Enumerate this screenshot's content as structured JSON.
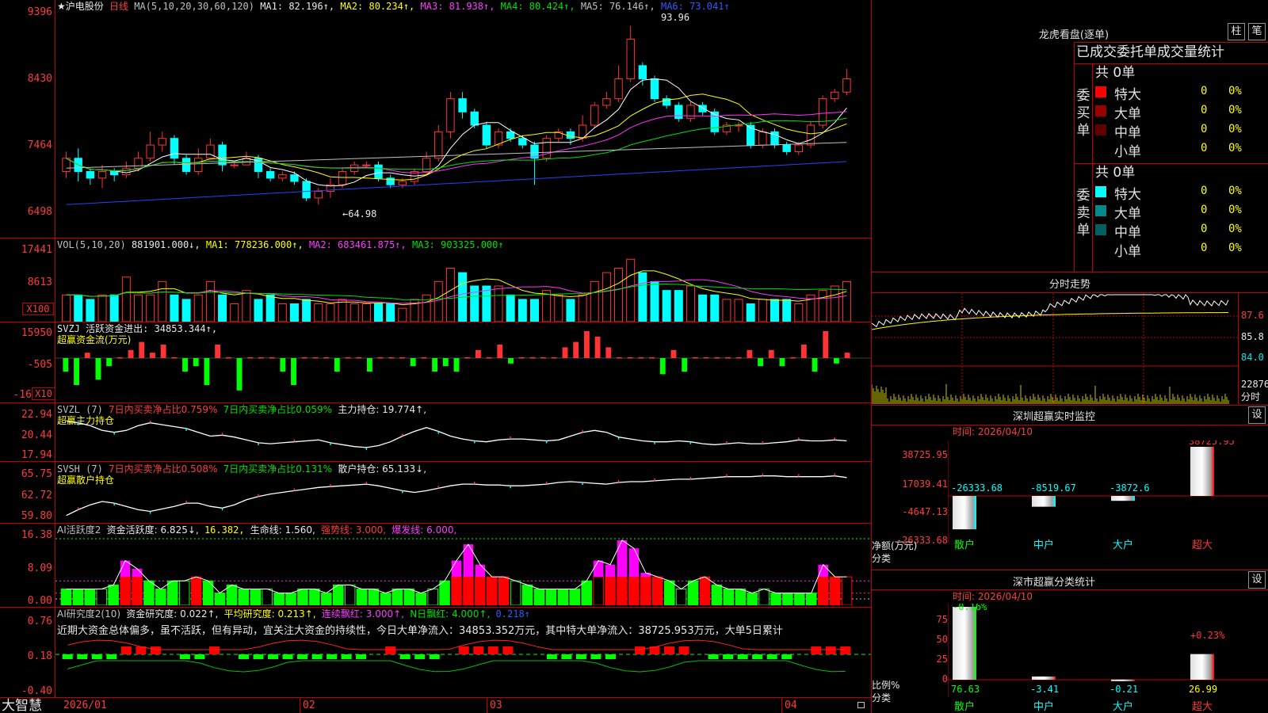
{
  "bottom_bar": {
    "brand": "大智慧",
    "dates": [
      "2026/01",
      "02",
      "03",
      "04"
    ]
  },
  "kline": {
    "stock_name": "★沪电股份",
    "period": "日线",
    "ma_params": "MA(5,10,20,30,60,120)",
    "ma1": "MA1: 82.196↑,",
    "ma2": "MA2: 80.234↑,",
    "ma3": "MA3: 81.938↑,",
    "ma4": "MA4: 80.424↑,",
    "ma5": "MA5: 76.146↑,",
    "ma6": "MA6: 73.041↑",
    "axis": [
      "9396",
      "8430",
      "7464",
      "6498"
    ],
    "high_label": "93.96",
    "low_label": "←64.98",
    "candles": [
      [
        72,
        74,
        71,
        75
      ],
      [
        74,
        72,
        70.5,
        75.5
      ],
      [
        72,
        71,
        70,
        72.5
      ],
      [
        71,
        72,
        69.5,
        73
      ],
      [
        72,
        71.5,
        70.5,
        72.5
      ],
      [
        71.5,
        72.5,
        71,
        73.5
      ],
      [
        72.5,
        74,
        72,
        75
      ],
      [
        74,
        76,
        73.5,
        78
      ],
      [
        76,
        77,
        75,
        78
      ],
      [
        77,
        74,
        73,
        77.5
      ],
      [
        74,
        72,
        71.5,
        74.5
      ],
      [
        72,
        74,
        71.5,
        75.5
      ],
      [
        74,
        76,
        74,
        77
      ],
      [
        76,
        73,
        72,
        76.5
      ],
      [
        73,
        73,
        72.5,
        73.5
      ],
      [
        73,
        74,
        73,
        75
      ],
      [
        74,
        72,
        71,
        74.5
      ],
      [
        72,
        71,
        70.5,
        72.5
      ],
      [
        71,
        71.5,
        70.5,
        72
      ],
      [
        71.5,
        70.5,
        70,
        72
      ],
      [
        70.5,
        68,
        67.5,
        71
      ],
      [
        68,
        69,
        67,
        69.5
      ],
      [
        69,
        70,
        68,
        71
      ],
      [
        70,
        72,
        69.5,
        72.5
      ],
      [
        72,
        73,
        71.5,
        73.5
      ],
      [
        73,
        73,
        72.5,
        73.5
      ],
      [
        73,
        71,
        70.5,
        73.5
      ],
      [
        71,
        70,
        69.5,
        71.5
      ],
      [
        70,
        70.5,
        69.5,
        71
      ],
      [
        70.5,
        72,
        70,
        72.5
      ],
      [
        72,
        74,
        71.5,
        75
      ],
      [
        74,
        78,
        73.5,
        79
      ],
      [
        78,
        83,
        77,
        84
      ],
      [
        83,
        81,
        80,
        84
      ],
      [
        81,
        79,
        78.5,
        81.5
      ],
      [
        79,
        76,
        75.5,
        79.5
      ],
      [
        76,
        78,
        75.5,
        78.5
      ],
      [
        78,
        77,
        76.5,
        78.5
      ],
      [
        77,
        76,
        75.5,
        77.5
      ],
      [
        76,
        74,
        70,
        76.5
      ],
      [
        74,
        77,
        73.5,
        77.5
      ],
      [
        77,
        78,
        76.5,
        78.5
      ],
      [
        78,
        77,
        76,
        78.5
      ],
      [
        77,
        79,
        76.5,
        80.5
      ],
      [
        79,
        82,
        78.5,
        82.5
      ],
      [
        82,
        83,
        81.5,
        84
      ],
      [
        83,
        86,
        82.5,
        88
      ],
      [
        86,
        92,
        85.5,
        94
      ],
      [
        88,
        86,
        85,
        88.5
      ],
      [
        86,
        83,
        82.5,
        86.5
      ],
      [
        83,
        82,
        81.5,
        83.5
      ],
      [
        82,
        80,
        79.5,
        82.5
      ],
      [
        80,
        82,
        79.5,
        82.5
      ],
      [
        82,
        81,
        80.5,
        82.5
      ],
      [
        81,
        78,
        77.5,
        81.5
      ],
      [
        78,
        79,
        77.5,
        79.5
      ],
      [
        79,
        79,
        78,
        79.5
      ],
      [
        79,
        76,
        75.5,
        79.5
      ],
      [
        76,
        78,
        75.5,
        78.5
      ],
      [
        78,
        76,
        75.5,
        78.5
      ],
      [
        76,
        75,
        74.5,
        76.5
      ],
      [
        75,
        76,
        74.5,
        76.5
      ],
      [
        76,
        79,
        75.5,
        79.5
      ],
      [
        79,
        83,
        78.5,
        83.5
      ],
      [
        83,
        84,
        82.5,
        84.5
      ],
      [
        84,
        86,
        83.5,
        87.5
      ]
    ]
  },
  "vol": {
    "label": "VOL(5,10,20)",
    "cur": "881901.000↓,",
    "ma1": "MA1: 778236.000↑,",
    "ma2": "MA2: 683461.875↑,",
    "ma3": "MA3: 903325.000↑",
    "axis": [
      "17441",
      "8613"
    ],
    "unit": "X100",
    "values": [
      6,
      6,
      5,
      6,
      6,
      10,
      6,
      6,
      9,
      6,
      5,
      6,
      9,
      6,
      4,
      7,
      5,
      6,
      4,
      4,
      5,
      4,
      4,
      5,
      4,
      4,
      4,
      4,
      3,
      5,
      6,
      9,
      12,
      11,
      8,
      8,
      8,
      6,
      5,
      5,
      7,
      6,
      5,
      6,
      9,
      11,
      12,
      14,
      11,
      9,
      7,
      7,
      8,
      6,
      6,
      5,
      5,
      4,
      5,
      5,
      5,
      4,
      6,
      7,
      8,
      9
    ]
  },
  "svzj": {
    "label": "SVZJ  活跃资金进出: 34853.344↑,",
    "sub": "超赢资金流(万元)",
    "axis": [
      "15950",
      "-505",
      "-16"
    ],
    "unit": "X10",
    "values": [
      -0.5,
      -1,
      0.2,
      -0.8,
      -0.3,
      0,
      0.3,
      0.6,
      0.2,
      0.5,
      0,
      -0.5,
      -0.3,
      -1,
      0.5,
      0,
      -1.2,
      0,
      0,
      0,
      -0.5,
      -1,
      0,
      0,
      0,
      -0.5,
      0,
      0,
      -0.5,
      0,
      0,
      0,
      -0.3,
      0,
      -0.5,
      -0.3,
      -0.5,
      0,
      0.3,
      0,
      0.5,
      -0.2,
      0,
      0,
      0,
      0,
      0.4,
      0.6,
      1,
      0.8,
      0.4,
      0,
      0,
      0,
      0,
      -0.6,
      0.3,
      -0.5,
      0,
      0,
      0,
      0,
      0,
      0.3,
      -0.3,
      0.3,
      -0.3,
      0,
      0.5,
      -0.5,
      1,
      -0.2,
      0.2
    ]
  },
  "svzl": {
    "label": "SVZL (7)",
    "t1": "7日内买卖净占比0.759%",
    "t2": "7日内买卖净占比0.059%",
    "t3": "主力持仓: 19.774↑,",
    "sub": "超赢主力持仓",
    "axis": [
      "22.94",
      "20.44",
      "17.94"
    ],
    "values": [
      22,
      21.8,
      21.5,
      21,
      20.8,
      21,
      21.5,
      21.8,
      21.6,
      21.4,
      21.2,
      20.8,
      20.4,
      20.5,
      20.3,
      20,
      19.7,
      19.6,
      19.7,
      19.8,
      19.9,
      20,
      19.7,
      19.5,
      19.3,
      19.2,
      19.4,
      19.8,
      20.4,
      20.9,
      21.3,
      20.9,
      20.4,
      20.1,
      19.9,
      19.8,
      20,
      20.1,
      20.1,
      20,
      19.9,
      20,
      20.4,
      20.8,
      21,
      20.8,
      20.3,
      20.1,
      19.9,
      19.8,
      19.8,
      19.9,
      19.8,
      19.6,
      19.5,
      19.6,
      19.7,
      19.6,
      19.6,
      19.7,
      19.8,
      20,
      19.9,
      19.9,
      20,
      19.9
    ]
  },
  "svsh": {
    "label": "SVSH (7)",
    "t1": "7日内买卖净占比0.508%",
    "t2": "7日内买卖净占比0.131%",
    "t3": "散户持仓: 65.133↓,",
    "sub": "超赢散户持仓",
    "axis": [
      "65.75",
      "62.72",
      "59.80"
    ],
    "values": [
      60.5,
      61.2,
      61.8,
      62.2,
      62,
      61.6,
      61.2,
      61,
      61.3,
      61.6,
      62,
      62,
      61.6,
      61.4,
      61.8,
      62.4,
      62.8,
      63.1,
      63.3,
      63.5,
      63.7,
      63.9,
      64,
      64.1,
      64.2,
      64.3,
      64.1,
      63.8,
      63.5,
      63.3,
      63.5,
      63.8,
      64.1,
      64.3,
      64.3,
      64.2,
      64.2,
      64.1,
      64.1,
      64.2,
      64.3,
      64.5,
      64.6,
      64.5,
      64.4,
      64.3,
      64.5,
      64.6,
      64.6,
      64.7,
      64.8,
      64.9,
      64.9,
      65,
      65.1,
      65.2,
      65.2,
      65.2,
      65.3,
      65.3,
      65.2,
      65.2,
      65.2,
      65.2,
      65.3,
      65.1
    ]
  },
  "ai_act": {
    "label": "AI活跃度2",
    "t1": "资金活跃度: 6.825↓,",
    "t2": "16.382,",
    "t3": "生命线: 1.560,",
    "t4": "强势线: 3.000,",
    "t5": "爆发线: 6.000,",
    "axis": [
      "16.38",
      "8.09",
      "0.00"
    ],
    "values": [
      4,
      4,
      4,
      4,
      5,
      11,
      9,
      6,
      4,
      6,
      6,
      7,
      6,
      3,
      5,
      4,
      4,
      4,
      3,
      3,
      4,
      4,
      3,
      5,
      5,
      4,
      4,
      3,
      4,
      4,
      3,
      4,
      6,
      11,
      15,
      10,
      7,
      7,
      6,
      5,
      4,
      4,
      4,
      4,
      6,
      11,
      10,
      16,
      14,
      8,
      7,
      6,
      4,
      6,
      7,
      5,
      4,
      4,
      3,
      4,
      3,
      3,
      3,
      3,
      10,
      7,
      7
    ]
  },
  "ai_res": {
    "label": "AI研究度2(10)",
    "t1": "资金研究度: 0.022↑,",
    "t2": "平均研究度: 0.213↑,",
    "t3": "连续飘红: 3.000↑,",
    "t4": "N日飘红: 4.000↑,",
    "t5": "0.218↑",
    "desc": "近期大资金总体偏多，虽不活跃，但有异动，宜关注大资金的持续性，今日大单净流入：34853.352万元，其中特大单净流入：38725.953万元，大单5日累计",
    "axis": [
      "0.76",
      "0.18",
      "-0.40"
    ],
    "bars": [
      -1,
      -1,
      -1,
      -1,
      1,
      1,
      1,
      0,
      -1,
      -1,
      1,
      0,
      -1,
      -1,
      -1,
      -1,
      -1,
      -1,
      -1,
      -1,
      -1,
      0,
      1,
      -1,
      -1,
      -1,
      0,
      1,
      1,
      1,
      1,
      0,
      0,
      -1,
      -1,
      -1,
      -1,
      -1,
      0,
      1,
      1,
      1,
      1,
      0,
      -1,
      -1,
      -1,
      -1,
      -1,
      -1,
      0,
      1,
      1,
      1
    ]
  },
  "lhb": {
    "title": "龙虎看盘(逐单)",
    "btn1": "柱",
    "btn2": "笔",
    "header": "已成交委托单成交量统计",
    "buy_label": "委买单",
    "sell_label": "委卖单",
    "buy_total": "共 0单",
    "sell_total": "共 0单",
    "buy_rows": [
      {
        "name": "特大",
        "count": "0",
        "pct": "0%",
        "color": "#ff0000"
      },
      {
        "name": "大单",
        "count": "0",
        "pct": "0%",
        "color": "#9a0000"
      },
      {
        "name": "中单",
        "count": "0",
        "pct": "0%",
        "color": "#600000"
      },
      {
        "name": "小单",
        "count": "0",
        "pct": "0%",
        "color": "#000000"
      }
    ],
    "sell_rows": [
      {
        "name": "特大",
        "count": "0",
        "pct": "0%",
        "color": "#00ffff"
      },
      {
        "name": "大单",
        "count": "0",
        "pct": "0%",
        "color": "#008a8a"
      },
      {
        "name": "中单",
        "count": "0",
        "pct": "0%",
        "color": "#006060"
      },
      {
        "name": "小单",
        "count": "0",
        "pct": "0%",
        "color": "#000000"
      }
    ]
  },
  "fenshi": {
    "title": "分时走势",
    "axis": [
      "87.6",
      "85.8",
      "84.0"
    ],
    "vol_axis": "22876",
    "unit": "分时"
  },
  "monitor": {
    "title": "深圳超赢实时监控",
    "btn": "设",
    "time": "时间: 2026/04/10",
    "ylabels": [
      "38725.95",
      "17039.41",
      "-4647.13",
      "-26333.68"
    ],
    "xlabel": "净额(万元)",
    "cat_label": "分类",
    "categories": [
      "散户",
      "中户",
      "大户",
      "超大"
    ],
    "values": [
      -26333.68,
      -8519.67,
      -3872.6,
      38725.95
    ],
    "value_labels": [
      "-26333.68",
      "-8519.67",
      "-3872.6",
      "38725.95"
    ]
  },
  "classify": {
    "title": "深市超赢分类统计",
    "btn": "设",
    "time": "时间: 2026/04/10",
    "ylabels": [
      "75",
      "50",
      "25",
      "0"
    ],
    "ylabel": "比例%",
    "cat_label": "分类",
    "categories": [
      "散户",
      "中户",
      "大户",
      "超大"
    ],
    "top_labels": [
      "-0.16%",
      "",
      "",
      "+0.23%"
    ],
    "values": [
      76.63,
      3.41,
      0.21,
      26.99
    ],
    "value_labels": [
      "76.63",
      "-3.41",
      "-0.21",
      "26.99"
    ]
  }
}
